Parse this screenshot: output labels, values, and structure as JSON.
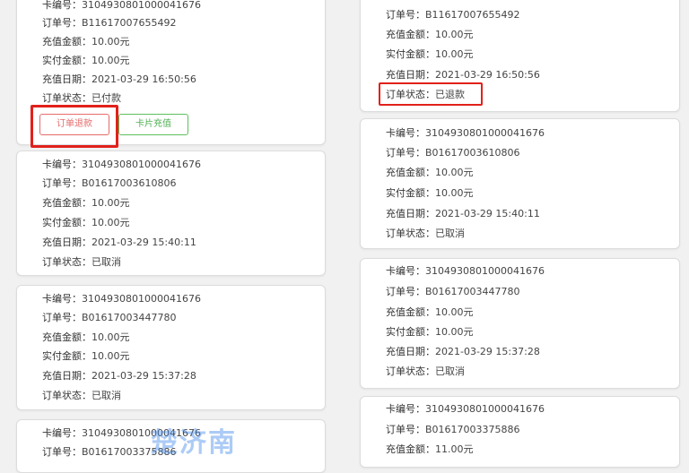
{
  "labels": {
    "card_no": "卡编号：",
    "order_no": "订单号：",
    "recharge_amount": "充值金额：",
    "paid_amount": "实付金额：",
    "recharge_date": "充值日期：",
    "order_status": "订单状态："
  },
  "left": {
    "orders": [
      {
        "card_no": "",
        "order_no": "B11617007655492",
        "recharge_amount": "10.00元",
        "paid_amount": "10.00元",
        "recharge_date": "2021-03-29 16:50:56",
        "order_status": "已付款",
        "buttons": {
          "refund": "订单退款",
          "card_recharge": "卡片充值"
        }
      },
      {
        "card_no": "3104930801000041676",
        "order_no": "B01617003610806",
        "recharge_amount": "10.00元",
        "paid_amount": "10.00元",
        "recharge_date": "2021-03-29 15:40:11",
        "order_status": "已取消"
      },
      {
        "card_no": "3104930801000041676",
        "order_no": "B01617003447780",
        "recharge_amount": "10.00元",
        "paid_amount": "10.00元",
        "recharge_date": "2021-03-29 15:37:28",
        "order_status": "已取消"
      },
      {
        "card_no": "3104930801000041676",
        "order_no": "B01617003375886"
      }
    ]
  },
  "right": {
    "orders": [
      {
        "order_no": "B11617007655492",
        "recharge_amount": "10.00元",
        "paid_amount": "10.00元",
        "recharge_date": "2021-03-29 16:50:56",
        "order_status": "已退款"
      },
      {
        "card_no": "3104930801000041676",
        "order_no": "B01617003610806",
        "recharge_amount": "10.00元",
        "paid_amount": "10.00元",
        "recharge_date": "2021-03-29 15:40:11",
        "order_status": "已取消"
      },
      {
        "card_no": "3104930801000041676",
        "order_no": "B01617003447780",
        "recharge_amount": "10.00元",
        "paid_amount": "10.00元",
        "recharge_date": "2021-03-29 15:37:28",
        "order_status": "已取消"
      },
      {
        "card_no": "3104930801000041676",
        "order_no": "B01617003375886",
        "recharge_amount": "11.00元"
      }
    ]
  },
  "watermark": "楚济南",
  "colors": {
    "highlight": "#e2201b",
    "refund_button": "#e56b6b",
    "recharge_button": "#4caf50",
    "watermark": "#488ceb"
  }
}
